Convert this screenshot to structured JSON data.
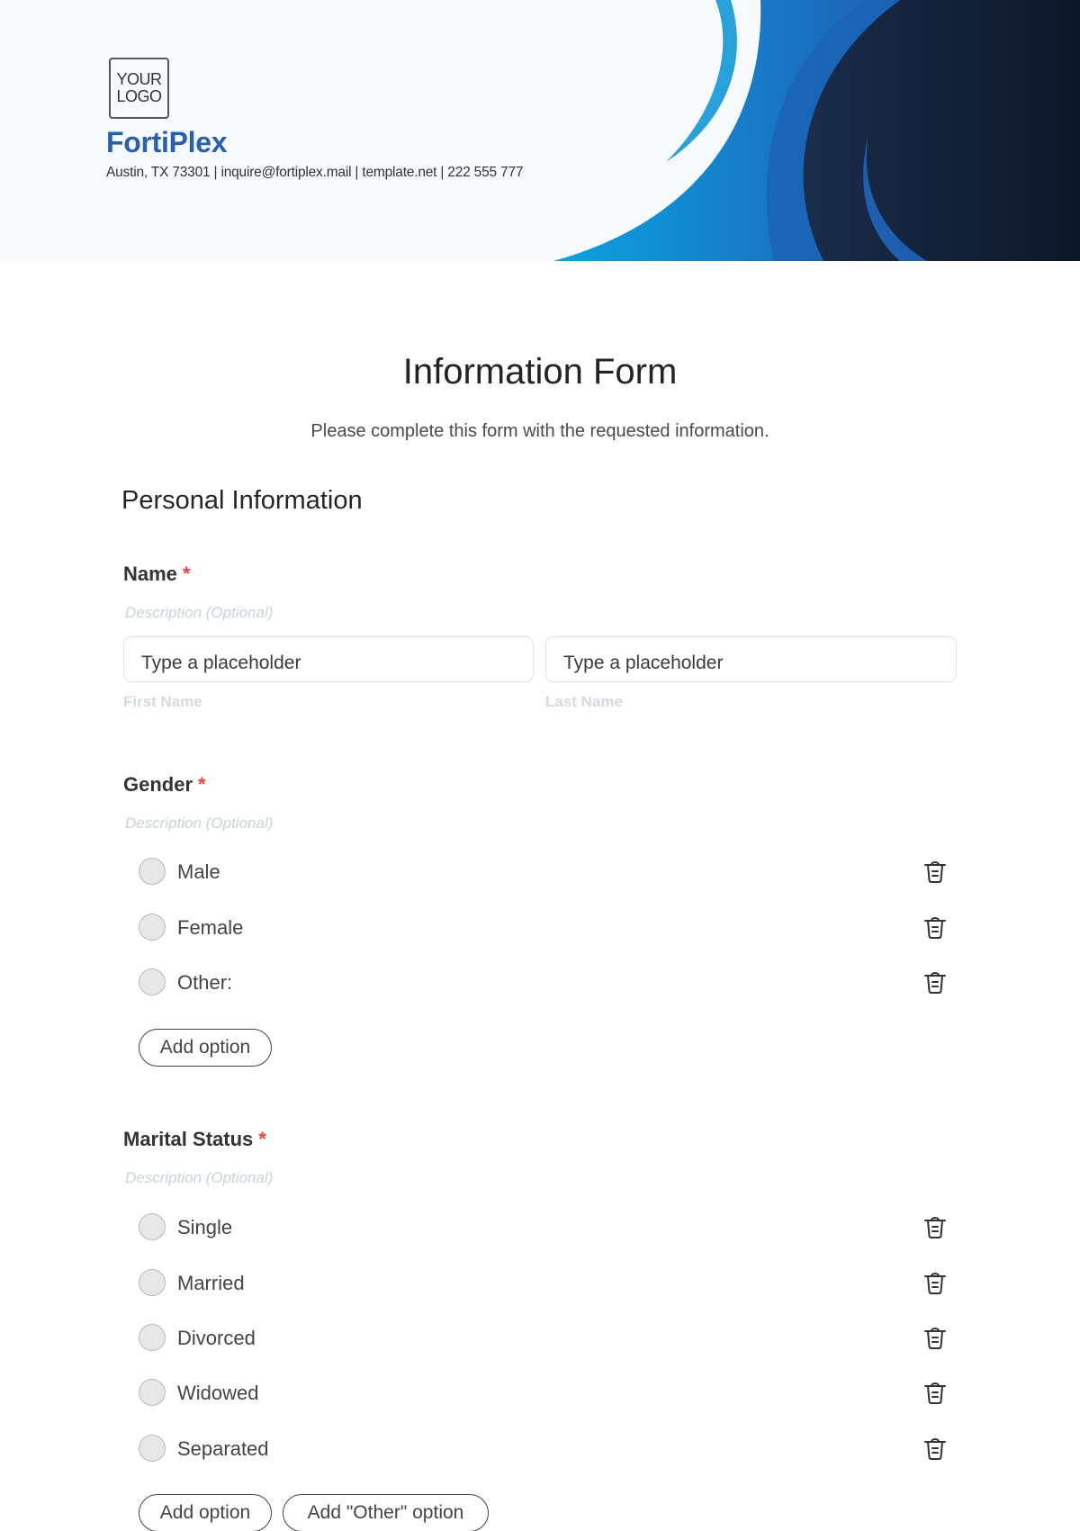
{
  "header": {
    "logo_line1": "YOUR",
    "logo_line2": "LOGO",
    "company": "FortiPlex",
    "contact": "Austin, TX 73301 | inquire@fortiplex.mail | template.net | 222 555 777",
    "colors": {
      "brand": "#2a5fb0",
      "wave_light": "#27a0dc",
      "wave_mid": "#1b63b5",
      "wave_dark": "#111e33"
    }
  },
  "form": {
    "title": "Information Form",
    "subtitle": "Please complete this form with the requested information."
  },
  "section": {
    "title": "Personal Information"
  },
  "questions": {
    "name": {
      "label": "Name",
      "required_mark": "*",
      "description": "Description (Optional)",
      "fields": [
        {
          "placeholder": "Type a placeholder",
          "sublabel": "First Name"
        },
        {
          "placeholder": "Type a placeholder",
          "sublabel": "Last Name"
        }
      ]
    },
    "gender": {
      "label": "Gender",
      "required_mark": "*",
      "description": "Description (Optional)",
      "options": [
        "Male",
        "Female",
        "Other:"
      ],
      "add_option": "Add option"
    },
    "marital": {
      "label": "Marital Status",
      "required_mark": "*",
      "description": "Description (Optional)",
      "options": [
        "Single",
        "Married",
        "Divorced",
        "Widowed",
        "Separated"
      ],
      "add_option": "Add option",
      "add_other_option": "Add \"Other\" option"
    }
  },
  "icons": {
    "delete": "trash-icon",
    "radio": "radio-unselected"
  }
}
